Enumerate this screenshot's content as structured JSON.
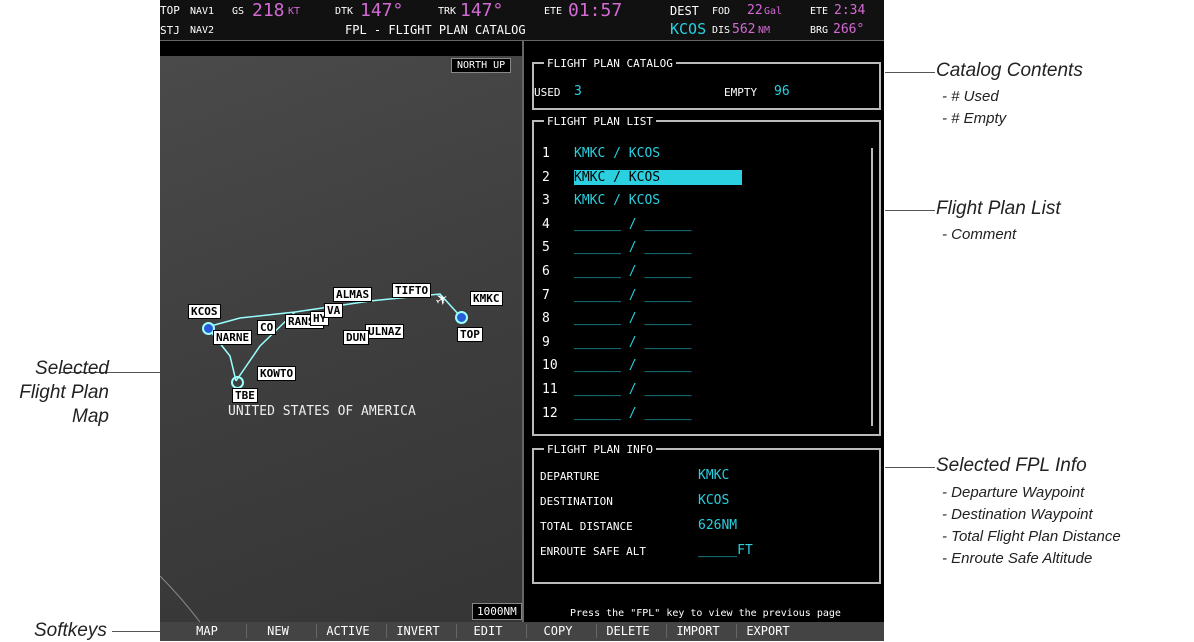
{
  "header": {
    "row1": {
      "top": "TOP",
      "nav1": "NAV1",
      "gs_label": "GS",
      "gs_value": "218",
      "gs_unit": "KT",
      "dtk_label": "DTK",
      "dtk_value": "147°",
      "trk_label": "TRK",
      "trk_value": "147°",
      "ete_label": "ETE",
      "ete_value": "01:57",
      "dest_label": "DEST",
      "fod_label": "FOD",
      "fod_value": "22",
      "fod_unit": "Gal",
      "ete2_label": "ETE",
      "ete2_value": "2:34"
    },
    "row2": {
      "stj": "STJ",
      "nav2": "NAV2",
      "page_title": "FPL - FLIGHT PLAN CATALOG",
      "dest_value": "KCOS",
      "dis_label": "DIS",
      "dis_value": "562",
      "dis_unit": "NM",
      "brg_label": "BRG",
      "brg_value": "266°"
    }
  },
  "map": {
    "orientation": "NORTH UP",
    "range": "1000NM",
    "country": "UNITED STATES OF AMERICA",
    "waypoints": [
      "KCOS",
      "NARNE",
      "RANSO",
      "ALMAS",
      "ULNAZ",
      "TIFTO",
      "KMKC",
      "TOP",
      "KOWTO",
      "TBE",
      "DUN",
      "HY",
      "VA",
      "CO"
    ]
  },
  "catalog": {
    "title": "FLIGHT PLAN CATALOG",
    "used_label": "USED",
    "used_value": "3",
    "empty_label": "EMPTY",
    "empty_value": "96"
  },
  "plan_list": {
    "title": "FLIGHT PLAN LIST",
    "selected_index": 1,
    "items": [
      {
        "num": "1",
        "text": "KMKC / KCOS"
      },
      {
        "num": "2",
        "text": "KMKC / KCOS"
      },
      {
        "num": "3",
        "text": "KMKC / KCOS"
      },
      {
        "num": "4",
        "text": "______ / ______"
      },
      {
        "num": "5",
        "text": "______ / ______"
      },
      {
        "num": "6",
        "text": "______ / ______"
      },
      {
        "num": "7",
        "text": "______ / ______"
      },
      {
        "num": "8",
        "text": "______ / ______"
      },
      {
        "num": "9",
        "text": "______ / ______"
      },
      {
        "num": "10",
        "text": "______ / ______"
      },
      {
        "num": "11",
        "text": "______ / ______"
      },
      {
        "num": "12",
        "text": "______ / ______"
      }
    ]
  },
  "info": {
    "title": "FLIGHT PLAN INFO",
    "rows": [
      {
        "label": "DEPARTURE",
        "value": "KMKC"
      },
      {
        "label": "DESTINATION",
        "value": "KCOS"
      },
      {
        "label": "TOTAL DISTANCE",
        "value": "626NM"
      },
      {
        "label": "ENROUTE SAFE ALT",
        "value": "_____FT"
      }
    ]
  },
  "footer_msg": "Press the \"FPL\" key to view the previous page",
  "softkeys": [
    "MAP",
    "NEW",
    "ACTIVE",
    "INVERT",
    "EDIT",
    "COPY",
    "DELETE",
    "IMPORT",
    "EXPORT",
    ""
  ],
  "callouts": {
    "catalog": {
      "title": "Catalog Contents",
      "subs": [
        "- # Used",
        "- # Empty"
      ]
    },
    "list": {
      "title": "Flight Plan List",
      "subs": [
        "- Comment"
      ]
    },
    "info": {
      "title": "Selected FPL Info",
      "subs": [
        "- Departure Waypoint",
        "- Destination Waypoint",
        "- Total Flight Plan Distance",
        "- Enroute Safe Altitude"
      ]
    },
    "map": {
      "lines": [
        "Selected",
        "Flight Plan",
        "Map"
      ]
    },
    "softkeys": "Softkeys"
  }
}
